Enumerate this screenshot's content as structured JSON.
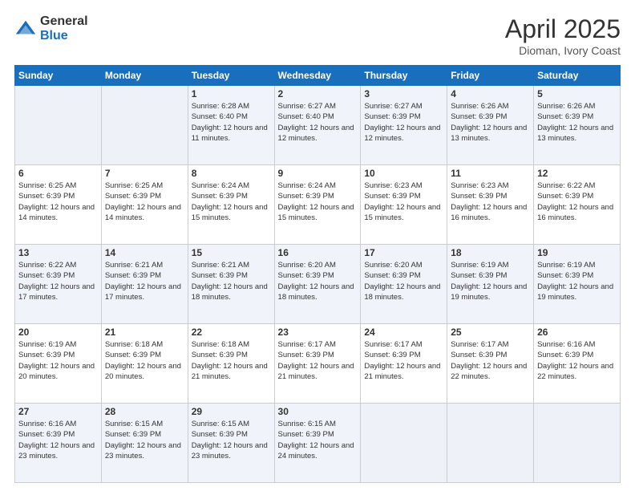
{
  "logo": {
    "general": "General",
    "blue": "Blue"
  },
  "header": {
    "month": "April 2025",
    "location": "Dioman, Ivory Coast"
  },
  "weekdays": [
    "Sunday",
    "Monday",
    "Tuesday",
    "Wednesday",
    "Thursday",
    "Friday",
    "Saturday"
  ],
  "weeks": [
    [
      {
        "day": "",
        "info": ""
      },
      {
        "day": "",
        "info": ""
      },
      {
        "day": "1",
        "info": "Sunrise: 6:28 AM\nSunset: 6:40 PM\nDaylight: 12 hours and 11 minutes."
      },
      {
        "day": "2",
        "info": "Sunrise: 6:27 AM\nSunset: 6:40 PM\nDaylight: 12 hours and 12 minutes."
      },
      {
        "day": "3",
        "info": "Sunrise: 6:27 AM\nSunset: 6:39 PM\nDaylight: 12 hours and 12 minutes."
      },
      {
        "day": "4",
        "info": "Sunrise: 6:26 AM\nSunset: 6:39 PM\nDaylight: 12 hours and 13 minutes."
      },
      {
        "day": "5",
        "info": "Sunrise: 6:26 AM\nSunset: 6:39 PM\nDaylight: 12 hours and 13 minutes."
      }
    ],
    [
      {
        "day": "6",
        "info": "Sunrise: 6:25 AM\nSunset: 6:39 PM\nDaylight: 12 hours and 14 minutes."
      },
      {
        "day": "7",
        "info": "Sunrise: 6:25 AM\nSunset: 6:39 PM\nDaylight: 12 hours and 14 minutes."
      },
      {
        "day": "8",
        "info": "Sunrise: 6:24 AM\nSunset: 6:39 PM\nDaylight: 12 hours and 15 minutes."
      },
      {
        "day": "9",
        "info": "Sunrise: 6:24 AM\nSunset: 6:39 PM\nDaylight: 12 hours and 15 minutes."
      },
      {
        "day": "10",
        "info": "Sunrise: 6:23 AM\nSunset: 6:39 PM\nDaylight: 12 hours and 15 minutes."
      },
      {
        "day": "11",
        "info": "Sunrise: 6:23 AM\nSunset: 6:39 PM\nDaylight: 12 hours and 16 minutes."
      },
      {
        "day": "12",
        "info": "Sunrise: 6:22 AM\nSunset: 6:39 PM\nDaylight: 12 hours and 16 minutes."
      }
    ],
    [
      {
        "day": "13",
        "info": "Sunrise: 6:22 AM\nSunset: 6:39 PM\nDaylight: 12 hours and 17 minutes."
      },
      {
        "day": "14",
        "info": "Sunrise: 6:21 AM\nSunset: 6:39 PM\nDaylight: 12 hours and 17 minutes."
      },
      {
        "day": "15",
        "info": "Sunrise: 6:21 AM\nSunset: 6:39 PM\nDaylight: 12 hours and 18 minutes."
      },
      {
        "day": "16",
        "info": "Sunrise: 6:20 AM\nSunset: 6:39 PM\nDaylight: 12 hours and 18 minutes."
      },
      {
        "day": "17",
        "info": "Sunrise: 6:20 AM\nSunset: 6:39 PM\nDaylight: 12 hours and 18 minutes."
      },
      {
        "day": "18",
        "info": "Sunrise: 6:19 AM\nSunset: 6:39 PM\nDaylight: 12 hours and 19 minutes."
      },
      {
        "day": "19",
        "info": "Sunrise: 6:19 AM\nSunset: 6:39 PM\nDaylight: 12 hours and 19 minutes."
      }
    ],
    [
      {
        "day": "20",
        "info": "Sunrise: 6:19 AM\nSunset: 6:39 PM\nDaylight: 12 hours and 20 minutes."
      },
      {
        "day": "21",
        "info": "Sunrise: 6:18 AM\nSunset: 6:39 PM\nDaylight: 12 hours and 20 minutes."
      },
      {
        "day": "22",
        "info": "Sunrise: 6:18 AM\nSunset: 6:39 PM\nDaylight: 12 hours and 21 minutes."
      },
      {
        "day": "23",
        "info": "Sunrise: 6:17 AM\nSunset: 6:39 PM\nDaylight: 12 hours and 21 minutes."
      },
      {
        "day": "24",
        "info": "Sunrise: 6:17 AM\nSunset: 6:39 PM\nDaylight: 12 hours and 21 minutes."
      },
      {
        "day": "25",
        "info": "Sunrise: 6:17 AM\nSunset: 6:39 PM\nDaylight: 12 hours and 22 minutes."
      },
      {
        "day": "26",
        "info": "Sunrise: 6:16 AM\nSunset: 6:39 PM\nDaylight: 12 hours and 22 minutes."
      }
    ],
    [
      {
        "day": "27",
        "info": "Sunrise: 6:16 AM\nSunset: 6:39 PM\nDaylight: 12 hours and 23 minutes."
      },
      {
        "day": "28",
        "info": "Sunrise: 6:15 AM\nSunset: 6:39 PM\nDaylight: 12 hours and 23 minutes."
      },
      {
        "day": "29",
        "info": "Sunrise: 6:15 AM\nSunset: 6:39 PM\nDaylight: 12 hours and 23 minutes."
      },
      {
        "day": "30",
        "info": "Sunrise: 6:15 AM\nSunset: 6:39 PM\nDaylight: 12 hours and 24 minutes."
      },
      {
        "day": "",
        "info": ""
      },
      {
        "day": "",
        "info": ""
      },
      {
        "day": "",
        "info": ""
      }
    ]
  ]
}
